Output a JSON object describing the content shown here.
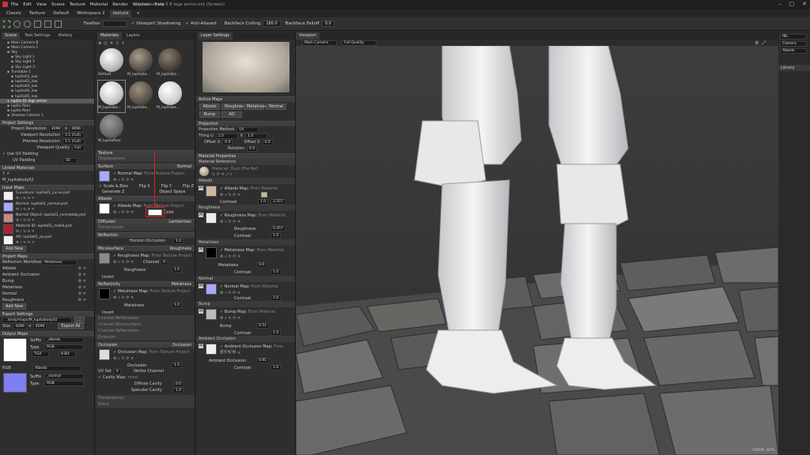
{
  "window": {
    "title": "lupita texture 3 8 legs armor.knt (Screen)",
    "menu": [
      "File",
      "Edit",
      "View",
      "Scene",
      "Texture",
      "Material",
      "Render",
      "Window",
      "Help"
    ]
  },
  "workspace_tabs": [
    "Classic",
    "Texture",
    "Default",
    "Workspace 2",
    "texture",
    "+"
  ],
  "toolbar": {
    "feather_label": "Feather",
    "viewport_shadowing": "✓ Viewport Shadowing",
    "anti_aliased": "✓ Anti-Aliased",
    "backface_culling": "Backface Culling",
    "backface_culling_value": "180.0",
    "backface_falloff": "Backface Falloff",
    "backface_falloff_value": "0.0"
  },
  "scene_panel": {
    "tabs": [
      "Scene",
      "Text Settings",
      "History"
    ],
    "items": [
      "Main Camera 8",
      "Main Camera 1",
      "Sky",
      "Sky Light 1",
      "Sky Light 2",
      "Sky Light 3",
      "Turntable 1",
      "lupita01_low",
      "lupita02_low",
      "lupita03_low",
      "lupita04_low",
      "lupita05_low",
      "lupita 01 legs armor",
      "lupita floor",
      "lupita floor",
      "Shadow Catcher 1"
    ],
    "project_settings": "Project Settings",
    "project_resolution": "Project Resolution",
    "proj_w": "4096",
    "proj_h": "4096",
    "viewport_resolution": "Viewport Resolution",
    "vp_res_val": "1:1 (Full)",
    "preview_resolution": "Preview Resolution",
    "prev_res_val": "1:1 (Full)",
    "viewport_quality": "Viewport Quality",
    "vp_quality_val": "Full",
    "use_uv_padding": "✓ Use UV Padding",
    "uv_padding": "UV Padding",
    "uv_padding_val": "16",
    "linked_materials": "Linked Materials",
    "linked_material_name": "M_lupitabody02",
    "input_maps": "Input Maps",
    "input_map_rows": [
      "Curvature: lupita01_curve.psd",
      "Normal: lupita01_normal.psd",
      "Normal Object: lupita01_normalobj.psd",
      "Material ID: lupita01_matid.psd",
      "AO: lupita01_ao.psd"
    ],
    "add_new": "Add New",
    "project_maps": "Project Maps",
    "reflection_workflow": "Reflection Workflow",
    "reflection_workflow_val": "Metalness",
    "project_map_items": [
      "Albedo",
      "Ambient Occlusion",
      "Bump",
      "Metalness",
      "Normal",
      "Roughness"
    ],
    "add_new_2": "Add New",
    "export_settings": "Export Settings",
    "export_path": "...body/maps/M_lupitabody02",
    "size_label": "Size",
    "size_w": "4096",
    "size_h": "4096",
    "export_all": "Export All",
    "output_maps": "Output Maps",
    "output_suffix": "Suffix",
    "output_suffix_val": "_albedo",
    "output_type": "Type",
    "output_type_val": "RGB",
    "output_format": "TGA",
    "output_bits": "8 Bit",
    "output_rgb": "RGB",
    "output_albedo": "Albedo",
    "output_suffix_val2": "_normal",
    "output_type_val2": "RGB"
  },
  "materials_panel": {
    "tabs": [
      "Materials",
      "Layers"
    ],
    "thumbs": [
      "Default",
      "M_lupitabo...",
      "M_lupitabo...",
      "M_lupitabo...",
      "M_lupitabo...",
      "M_lupitabo...",
      "M_lupitafloor"
    ],
    "texture": "Texture",
    "displacement": "Displacement",
    "surface": "Surface",
    "surface_val": "Normal",
    "normal_map": "✓ Normal Map:",
    "from_texture_project": "From Texture Project",
    "scale_bias": "✓ Scale & Bias",
    "flip_x": "Flip X",
    "flip_y": "Flip Y",
    "flip_z": "Flip Z",
    "generate_z": "Generate Z",
    "object_space": "Object Space",
    "albedo": "Albedo",
    "albedo_map": "✓ Albedo Map:",
    "from_texture_project2": "From Texture Project",
    "color": "Color",
    "diffusion": "Diffusion",
    "diffusion_val": "Lambertian",
    "transmission": "Transmission",
    "reflection": "Reflection",
    "horizon_occlusion": "Horizon Occlusion",
    "horizon_val": "1.0",
    "microsurface": "Microsurface",
    "microsurface_val": "Roughness",
    "roughness_map": "✓ Roughness Map:",
    "from_texture_project3": "From Texture Project",
    "channel": "Channel",
    "channel_val": "R",
    "roughness": "Roughness",
    "roughness_val": "1.0",
    "invert": "Invert",
    "reflectivity": "Reflectivity",
    "reflectivity_val": "Metalness",
    "metalness_map": "✓ Metalness Map:",
    "from_texture_project4": "From Texture Project",
    "metalness": "Metalness",
    "metalness_val": "1.0",
    "invert2": "Invert",
    "channel_r": "Channel Reflectance",
    "channel_m": "Channel Microsurface",
    "channel_r2": "Channel Reflectance",
    "emission": "Emission",
    "occlusion": "Occlusion",
    "occlusion_val": "Occlusion",
    "occlusion_map": "✓ Occlusion Map:",
    "from_texture_project5": "From Texture Project",
    "occlusion_label": "Occlusion",
    "occlusion_num": "1.0",
    "uv_set": "UV Set",
    "uv_set_val": "0",
    "vertex_channel": "Vertex Channel",
    "cavity_map": "✓ Cavity Map:",
    "none": "none",
    "diffuse_cavity": "Diffuse Cavity",
    "diffuse_cavity_val": "0.0",
    "specular_cavity": "Specular Cavity",
    "specular_cavity_val": "1.0",
    "transparency": "Transparency",
    "extra": "Extra"
  },
  "layer_settings": {
    "tab": "Layer Settings",
    "active_maps": "Active Maps",
    "map_buttons": [
      "Albedo",
      "Roughness",
      "Metalness",
      "Normal",
      "Bump",
      "AO"
    ],
    "projection": "Projection",
    "projection_method": "Projection Method",
    "projection_method_val": "UV",
    "tiling_u": "Tiling U",
    "tiling_u_val": "1.0",
    "tiling_v": "V",
    "tiling_v_val": "1.0",
    "offset_u": "Offset U",
    "offset_u_val": "0.0",
    "offset_v": "Offset V",
    "offset_v_val": "0.0",
    "rotation": "Rotation",
    "rotation_val": "0.0",
    "material_properties": "Material Properties",
    "material_reference": "Material Reference",
    "material_ref_val": "Material: Dust (File Ref)",
    "albedo": "Albedo",
    "albedo_map": "✓ Albedo Map:",
    "from_material": "From Material",
    "contrast": "Contrast",
    "contrast_val": "1.0",
    "contrast_val2": "2.557",
    "roughness": "Roughness",
    "roughness_map": "✓ Roughness Map:",
    "from_material2": "From Material",
    "roughness_label": "Roughness",
    "roughness_val": "0.457",
    "contrast2": "Contrast",
    "contrast2_val": "1.0",
    "metalness": "Metalness",
    "metalness_map": "✓ Metalness Map:",
    "from_material3": "From Material",
    "metalness_label": "Metalness",
    "metalness_val": "0.0",
    "contrast3": "Contrast",
    "contrast3_val": "1.0",
    "normal": "Normal",
    "normal_map": "✓ Normal Map:",
    "from_material4": "From Material",
    "contrast4": "Contrast",
    "contrast4_val": "1.0",
    "bump": "Bump",
    "bump_map": "✓ Bump Map:",
    "from_material5": "From Material",
    "bump_label": "Bump",
    "bump_val": "0.51",
    "contrast5": "Contrast",
    "contrast5_val": "1.0",
    "ambient_occlusion": "Ambient Occlusion",
    "ao_map": "✓ Ambient Occlusion Map:",
    "from_material6": "From Material",
    "ao_label": "Ambient Occlusion",
    "ao_val": "0.91",
    "contrast6": "Contrast",
    "contrast6_val": "1.0"
  },
  "viewport": {
    "tab": "Viewport",
    "camera": "Main Camera",
    "quality": "Full Quality",
    "vram": "VRAM: 40%"
  },
  "right_panel": {
    "items": [
      "IBL",
      "Camera",
      "Albedo"
    ],
    "library": "Library"
  },
  "colors": {
    "accent_red": "#e02020",
    "selection": "#5a5a5a"
  }
}
